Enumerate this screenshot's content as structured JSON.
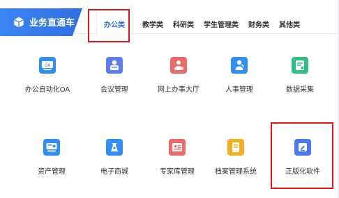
{
  "header": {
    "brand_title": "业务直通车",
    "tabs": [
      "办公类",
      "教学类",
      "科研类",
      "学生管理类",
      "财务类",
      "其他类"
    ]
  },
  "grid": {
    "items": [
      {
        "label": "办公自动化OA",
        "icon": "oa-icon",
        "color": "#2f8ff4",
        "icon_text": "OA"
      },
      {
        "label": "会议管理",
        "icon": "meeting-icon",
        "color": "#5a7df0"
      },
      {
        "label": "网上办事大厅",
        "icon": "service-hall-icon",
        "color": "#ee6a6a"
      },
      {
        "label": "人事管理",
        "icon": "personnel-icon",
        "color": "#2f8ff4"
      },
      {
        "label": "数据采集",
        "icon": "data-collect-icon",
        "color": "#2fbf83"
      },
      {
        "label": "资产管理",
        "icon": "asset-icon",
        "color": "#2f8ff4"
      },
      {
        "label": "电子商城",
        "icon": "ecommerce-icon",
        "color": "#2f8ff4"
      },
      {
        "label": "专家库管理",
        "icon": "expert-library-icon",
        "color": "#ee6a6a"
      },
      {
        "label": "档案管理系统",
        "icon": "archive-icon",
        "color": "#f2b01e"
      },
      {
        "label": "正版化软件",
        "icon": "licensed-software-icon",
        "color": "#4a78f0"
      }
    ]
  }
}
